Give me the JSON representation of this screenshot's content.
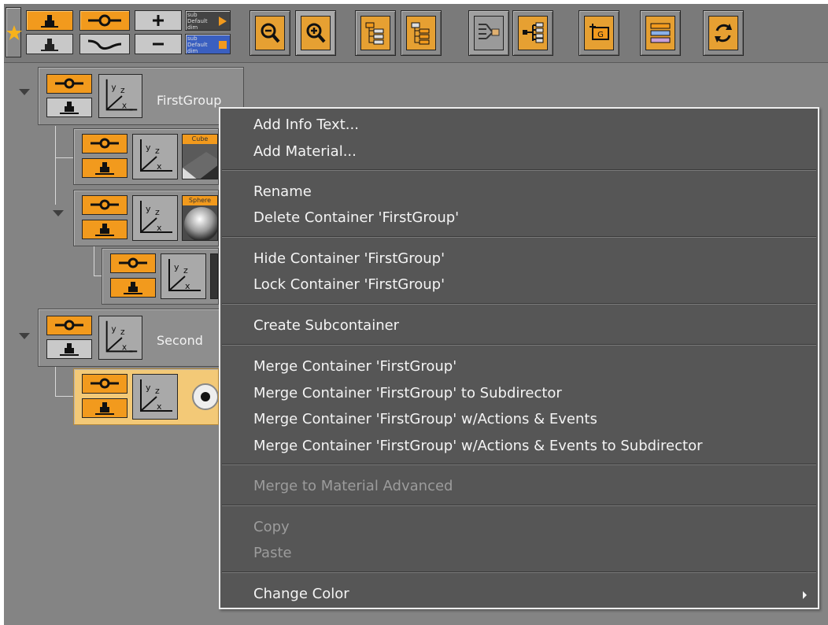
{
  "tree": {
    "nodes": [
      {
        "label": "FirstGroup",
        "expanded": true
      },
      {
        "thumbnail_label": "Cube"
      },
      {
        "thumbnail_label": "Sphere",
        "expanded": true
      },
      {},
      {
        "label": "Second",
        "expanded": true
      },
      {
        "selected": true
      }
    ]
  },
  "toolbar": {
    "small_button_labels": {
      "sub_default_dim_1": "sub Default dim",
      "sub_default_dim_2": "sub Default dim"
    },
    "icons": [
      "star-icon",
      "show-icon",
      "hide-icon",
      "animate-icon",
      "wave-icon",
      "plus-icon",
      "minus-icon",
      "zoom-out-icon",
      "zoom-in-icon",
      "tree-expand-icon",
      "tree-collapse-icon",
      "merge-in-icon",
      "merge-out-icon",
      "add-group-icon",
      "stack-icon",
      "refresh-icon"
    ]
  },
  "context_menu": {
    "items": [
      {
        "label": "Add Info Text...",
        "enabled": true
      },
      {
        "label": "Add Material...",
        "enabled": true
      },
      {
        "label": "Rename",
        "enabled": true
      },
      {
        "label": "Delete Container 'FirstGroup'",
        "enabled": true
      },
      {
        "label": "Hide Container 'FirstGroup'",
        "enabled": true
      },
      {
        "label": "Lock Container 'FirstGroup'",
        "enabled": true
      },
      {
        "label": "Create Subcontainer",
        "enabled": true
      },
      {
        "label": "Merge Container 'FirstGroup'",
        "enabled": true
      },
      {
        "label": "Merge Container 'FirstGroup' to Subdirector",
        "enabled": true
      },
      {
        "label": "Merge Container 'FirstGroup' w/Actions & Events",
        "enabled": true
      },
      {
        "label": "Merge Container 'FirstGroup' w/Actions & Events to Subdirector",
        "enabled": true
      },
      {
        "label": "Merge to Material Advanced",
        "enabled": false
      },
      {
        "label": "Copy",
        "enabled": false
      },
      {
        "label": "Paste",
        "enabled": false
      },
      {
        "label": "Change Color",
        "enabled": true,
        "has_submenu": true
      }
    ]
  },
  "colors": {
    "accent_orange": "#f29a1d",
    "panel_gray": "#848484",
    "menu_bg": "#565656",
    "menu_text": "#f4f4f4",
    "menu_disabled_text": "#9c9c9c",
    "selected_node": "#f3c977"
  }
}
